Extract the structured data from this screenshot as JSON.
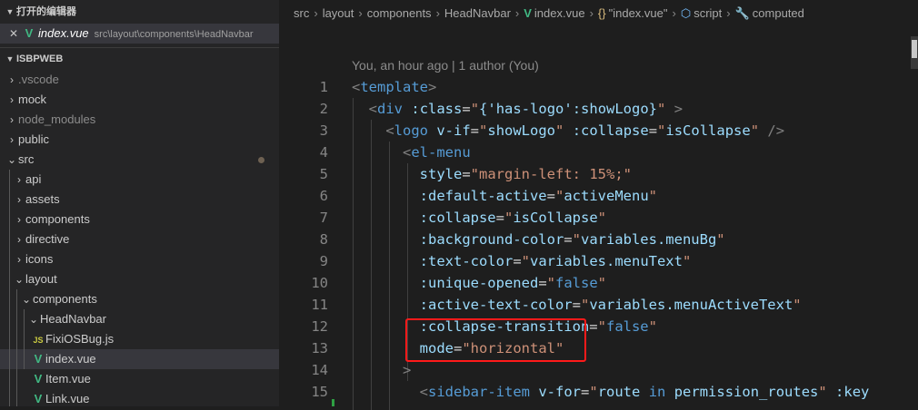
{
  "sidebar": {
    "open_editors_title": "打开的编辑器",
    "open_editor": {
      "name": "index.vue",
      "path": "src\\layout\\components\\HeadNavbar"
    },
    "project_title": "ISBPWEB",
    "tree": [
      {
        "label": ".vscode",
        "icon": "chevron-right",
        "dim": true
      },
      {
        "label": "mock",
        "icon": "chevron-right"
      },
      {
        "label": "node_modules",
        "icon": "chevron-right",
        "dim": true
      },
      {
        "label": "public",
        "icon": "chevron-right"
      },
      {
        "label": "src",
        "icon": "chevron-down"
      },
      {
        "label": "api",
        "icon": "chevron-right"
      },
      {
        "label": "assets",
        "icon": "chevron-right"
      },
      {
        "label": "components",
        "icon": "chevron-right"
      },
      {
        "label": "directive",
        "icon": "chevron-right"
      },
      {
        "label": "icons",
        "icon": "chevron-right"
      },
      {
        "label": "layout",
        "icon": "chevron-down"
      },
      {
        "label": "components",
        "icon": "chevron-down"
      },
      {
        "label": "HeadNavbar",
        "icon": "chevron-down"
      },
      {
        "label": "FixiOSBug.js",
        "icon": "js-file-icon",
        "badge": "JS"
      },
      {
        "label": "index.vue",
        "icon": "vue-file-icon"
      },
      {
        "label": "Item.vue",
        "icon": "vue-file-icon"
      },
      {
        "label": "Link.vue",
        "icon": "vue-file-icon"
      }
    ]
  },
  "breadcrumb": {
    "items": [
      "src",
      "layout",
      "components",
      "HeadNavbar",
      "index.vue",
      "\"index.vue\"",
      "script",
      "computed"
    ],
    "braces": "{}"
  },
  "codelens": "You, an hour ago | 1 author (You)",
  "line_numbers": [
    "1",
    "2",
    "3",
    "4",
    "5",
    "6",
    "7",
    "8",
    "9",
    "10",
    "11",
    "12",
    "13",
    "14",
    "15"
  ],
  "code": {
    "l1": {
      "tag": "template"
    },
    "l2": {
      "tag": "div",
      "attr": ":class",
      "value": "{'has-logo':showLogo}"
    },
    "l3": {
      "tag": "logo",
      "attr1": "v-if",
      "val1": "showLogo",
      "attr2": ":collapse",
      "val2": "isCollapse"
    },
    "l4": {
      "tag": "el-menu"
    },
    "l5": {
      "attr": "style",
      "value": "margin-left: 15%;"
    },
    "l6": {
      "attr": ":default-active",
      "value": "activeMenu"
    },
    "l7": {
      "attr": ":collapse",
      "value": "isCollapse"
    },
    "l8": {
      "attr": ":background-color",
      "value": "variables.menuBg"
    },
    "l9": {
      "attr": ":text-color",
      "value": "variables.menuText"
    },
    "l10": {
      "attr": ":unique-opened",
      "value": "false"
    },
    "l11": {
      "attr": ":active-text-color",
      "value": "variables.menuActiveText"
    },
    "l12": {
      "attr": ":collapse-transition",
      "value": "false"
    },
    "l13": {
      "attr": "mode",
      "value": "horizontal"
    },
    "l14": {
      "text": ">"
    },
    "l15": {
      "tag": "sidebar-item",
      "attr1": "v-for",
      "val1a": "route",
      "val1kw": "in",
      "val1b": "permission_routes",
      "attr2": ":key"
    }
  },
  "colors": {
    "highlight": "#ff1a1a",
    "vue": "#41b883",
    "string": "#ce9178",
    "attribute": "#9cdcfe",
    "tag": "#569cd6"
  }
}
